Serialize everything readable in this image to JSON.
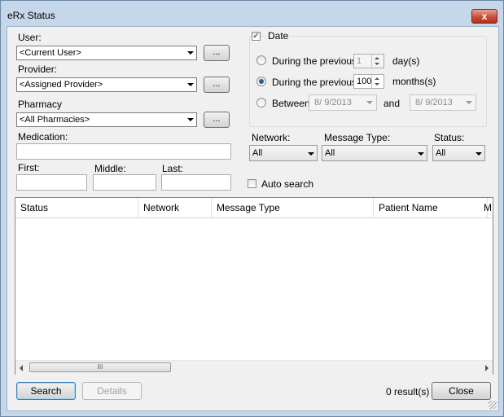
{
  "window": {
    "title": "eRx Status",
    "close_glyph": "x"
  },
  "filters": {
    "user_label": "User:",
    "user_value": "<Current User>",
    "provider_label": "Provider:",
    "provider_value": "<Assigned Provider>",
    "pharmacy_label": "Pharmacy",
    "pharmacy_value": "<All Pharmacies>",
    "browse_label": "...",
    "medication_label": "Medication:",
    "medication_value": "",
    "first_label": "First:",
    "middle_label": "Middle:",
    "last_label": "Last:"
  },
  "date": {
    "label": "Date",
    "checked": true,
    "previous_label": "During the previous",
    "days_value": "1",
    "days_unit": "day(s)",
    "months_value": "100",
    "months_unit": "months(s)",
    "between_label": "Between",
    "and_label": "and",
    "start_date": "8/ 9/2013",
    "end_date": "8/ 9/2013"
  },
  "dropdowns": {
    "network_label": "Network:",
    "network_value": "All",
    "message_type_label": "Message Type:",
    "message_type_value": "All",
    "status_label": "Status:",
    "status_value": "All"
  },
  "auto_search_label": "Auto search",
  "grid": {
    "columns": [
      "Status",
      "Network",
      "Message Type",
      "Patient Name",
      "M"
    ],
    "rows": [],
    "scroll_grip": "III"
  },
  "footer": {
    "search_label": "Search",
    "details_label": "Details",
    "result_count": "0 result(s)",
    "close_label": "Close"
  },
  "icons": [
    "close-icon",
    "dropdown-arrow-icon",
    "spin-up-icon",
    "spin-down-icon",
    "checkbox-check-icon",
    "radio-icon",
    "scroll-left-icon",
    "scroll-right-icon",
    "resize-grip-icon"
  ]
}
